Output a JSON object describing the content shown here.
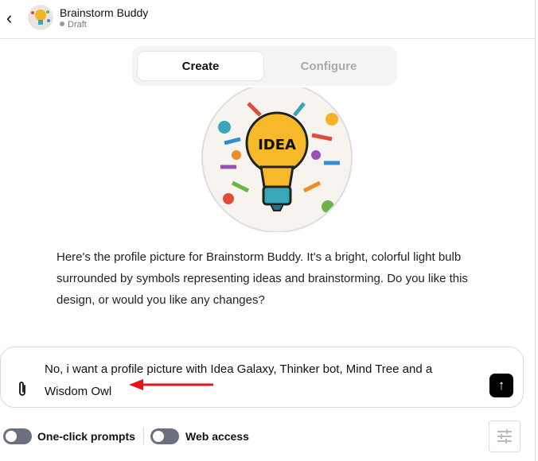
{
  "header": {
    "title": "Brainstorm Buddy",
    "status": "Draft"
  },
  "tabs": [
    {
      "label": "Create",
      "active": true
    },
    {
      "label": "Configure",
      "active": false
    }
  ],
  "profile_image": {
    "text": "IDEA"
  },
  "message": "Here's the profile picture for Brainstorm Buddy. It's a bright, colorful light bulb surrounded by symbols representing ideas and brainstorming. Do you like this design, or would you like any changes?",
  "composer": {
    "value": "No, i want a profile picture with Idea Galaxy, Thinker bot, Mind Tree and a Wisdom Owl"
  },
  "toggles": [
    {
      "label": "One-click prompts",
      "on": false
    },
    {
      "label": "Web access",
      "on": false
    }
  ],
  "colors": {
    "annotation_arrow": "#e8141b",
    "toggle_off": "#6b7080"
  }
}
